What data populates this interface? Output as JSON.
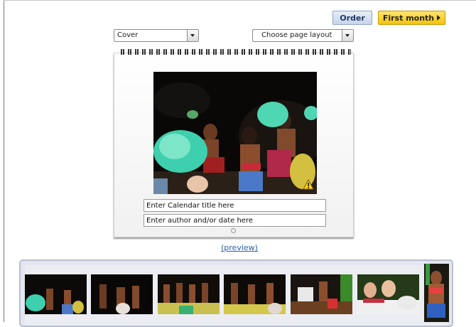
{
  "toolbar": {
    "order_label": "Order",
    "first_month_label": "First month"
  },
  "page_select": {
    "value": "Cover"
  },
  "layout_select": {
    "value": "Choose page layout"
  },
  "calendar": {
    "title_placeholder": "Enter Calendar title here",
    "author_placeholder": "Enter author and/or date here",
    "photo_warning": "warning-icon"
  },
  "preview_link": "(preview)",
  "thumbnails": [
    "photo-1",
    "photo-2",
    "photo-3",
    "photo-4",
    "photo-5",
    "photo-6",
    "photo-7"
  ],
  "colors": {
    "order_button": "#c7d5ea",
    "first_month_button": "#f4c20d",
    "link": "#2a5fb0",
    "strip_border": "#b8bfcf"
  }
}
